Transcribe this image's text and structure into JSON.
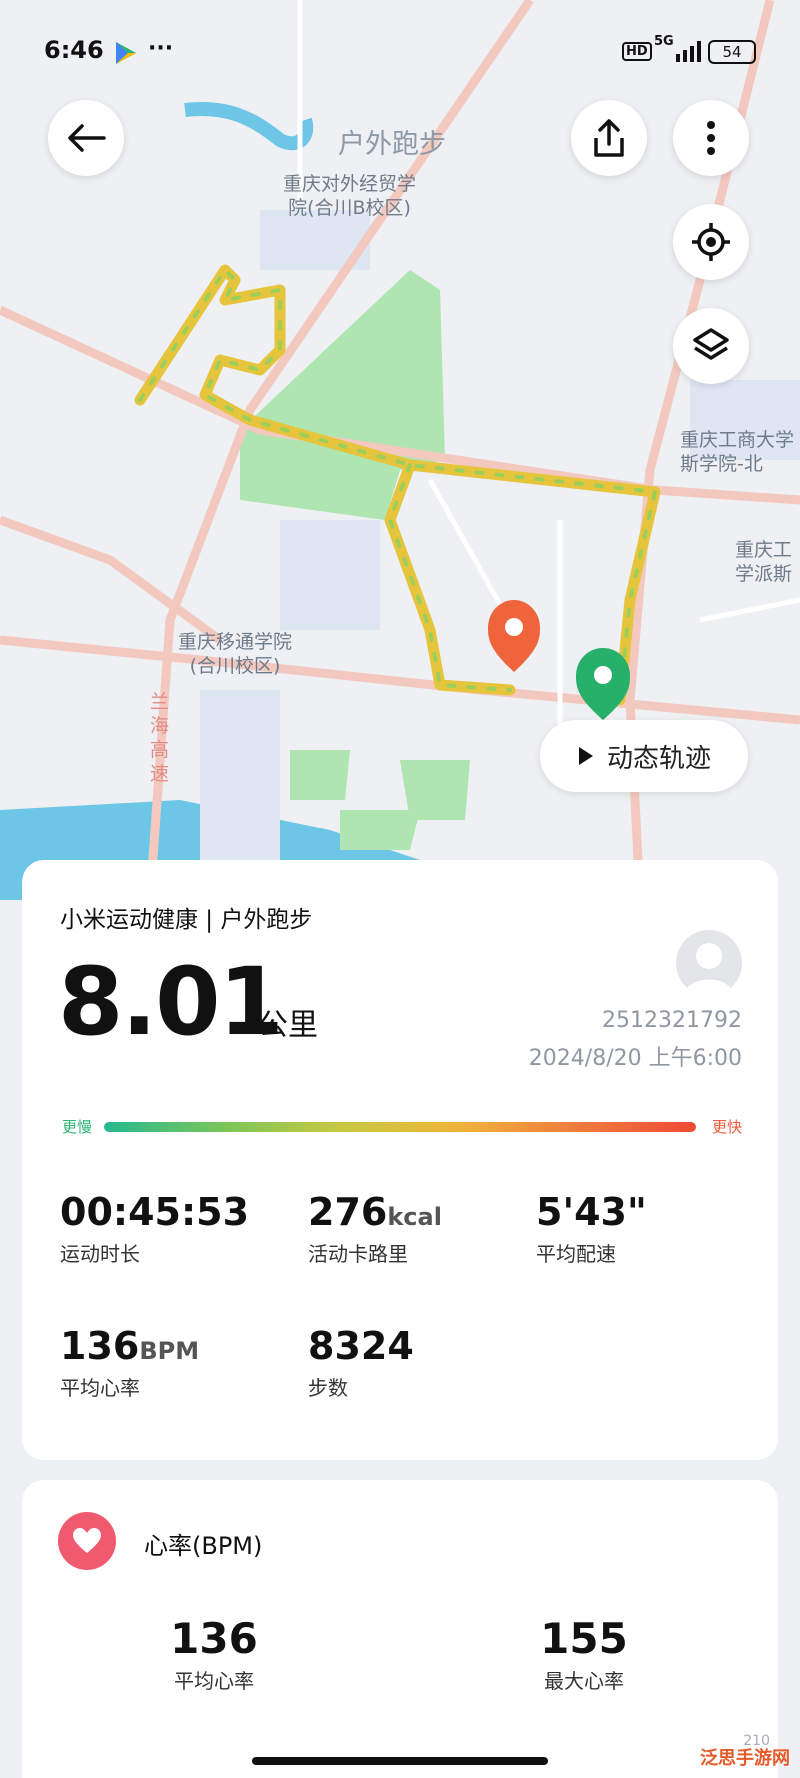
{
  "status_bar": {
    "time": "6:46",
    "signal": "5G",
    "hd": "HD",
    "battery": "54"
  },
  "map": {
    "title": "户外跑步",
    "labels": [
      {
        "text": "重庆对外经贸学\n院(合川B校区)"
      },
      {
        "text": "重庆移通学院\n(合川校区)"
      },
      {
        "text": "重庆工商大学\n斯学院-北"
      },
      {
        "text": "重庆工\n学派斯"
      },
      {
        "text": "兰\n海\n高\n速"
      }
    ]
  },
  "controls": {
    "back_icon": "arrow-left-icon",
    "share_icon": "share-icon",
    "more_icon": "more-icon",
    "locate_icon": "locate-icon",
    "layers_icon": "layers-icon"
  },
  "dynamic_track": {
    "label": "动态轨迹"
  },
  "summary": {
    "source": "小米运动健康 | 户外跑步",
    "distance": "8.01",
    "distance_unit": "公里",
    "user_id": "2512321792",
    "datetime": "2024/8/20 上午6:00",
    "pace_slow": "更慢",
    "pace_fast": "更快"
  },
  "stats": [
    {
      "value": "00:45:53",
      "unit": "",
      "label": "运动时长"
    },
    {
      "value": "276",
      "unit": "kcal",
      "label": "活动卡路里"
    },
    {
      "value": "5'43\"",
      "unit": "",
      "label": "平均配速"
    },
    {
      "value": "136",
      "unit": "BPM",
      "label": "平均心率"
    },
    {
      "value": "8324",
      "unit": "",
      "label": "步数"
    }
  ],
  "heart_rate": {
    "title": "心率(BPM)",
    "avg": {
      "value": "136",
      "label": "平均心率"
    },
    "max": {
      "value": "155",
      "label": "最大心率"
    },
    "axis_label": "210"
  },
  "watermark": "泛思手游网",
  "colors": {
    "route": "#e6c53c",
    "start_pin": "#26b06a",
    "end_pin": "#f0643c",
    "heart": "#f05a6e"
  }
}
